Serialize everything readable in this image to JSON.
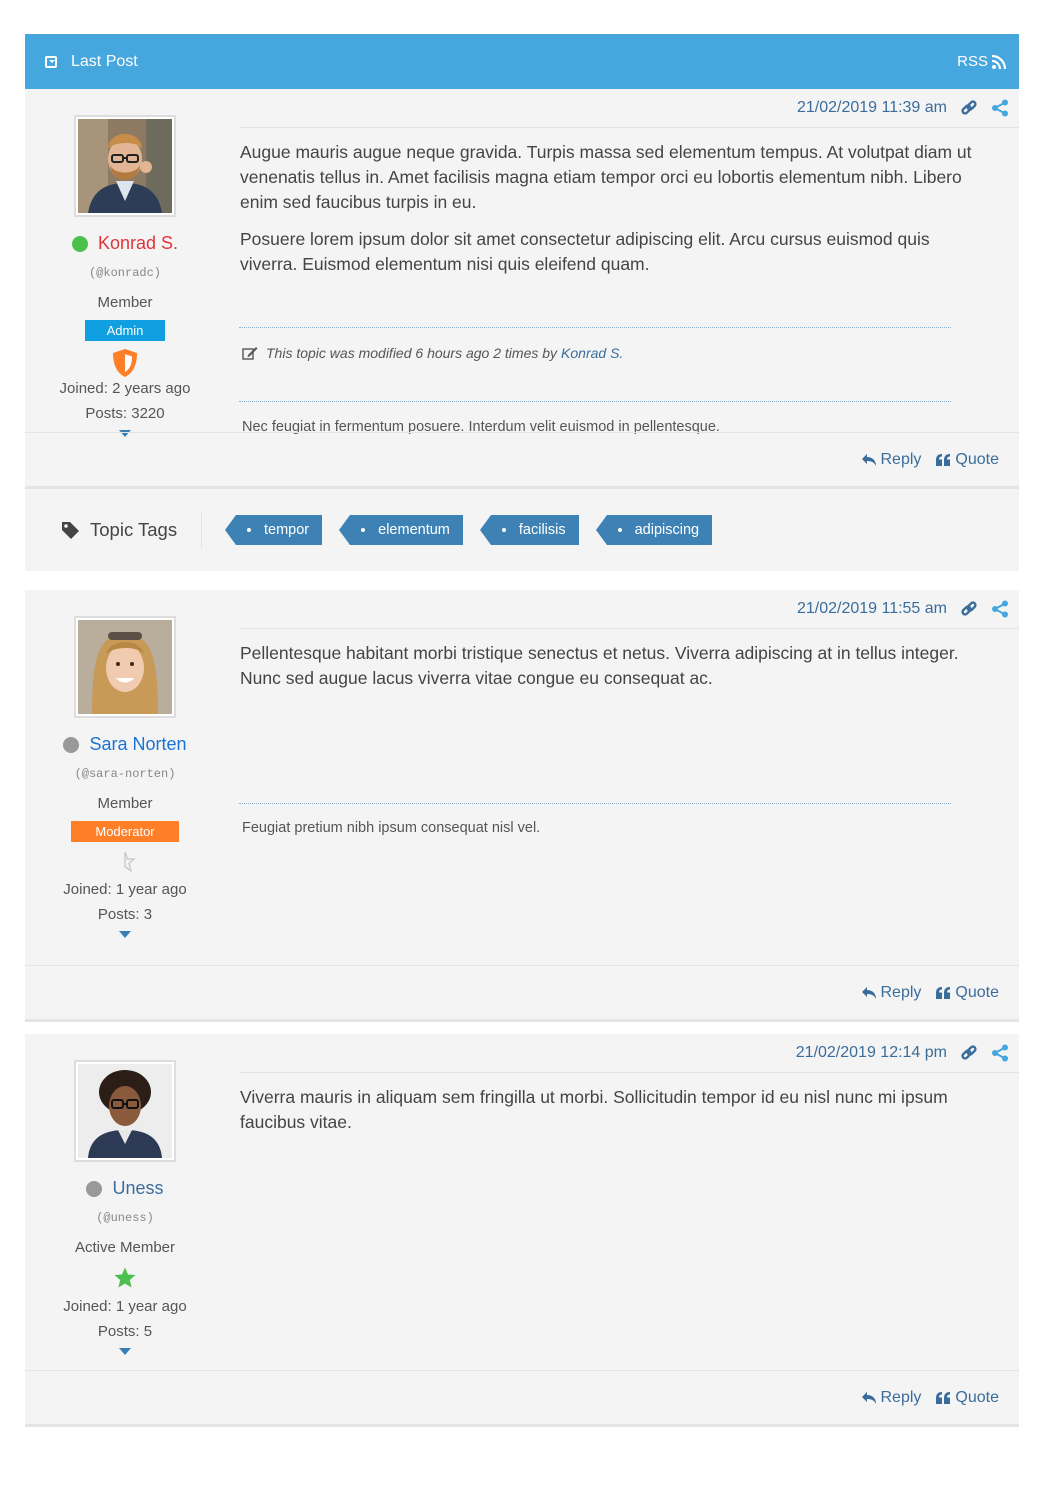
{
  "header": {
    "title": "Last Post",
    "rss_label": "RSS"
  },
  "colors": {
    "header_bg": "#46a6de",
    "link": "#3a6d9c",
    "online": "#4cc04c",
    "offline": "#999999",
    "admin_badge": "#109fe0",
    "moderator_badge": "#ff7f29",
    "tag_bg": "#3e82b5"
  },
  "posts": [
    {
      "date": "21/02/2019 11:39 am",
      "author": {
        "name": "Konrad S.",
        "name_color": "#e0343a",
        "status": "online",
        "handle": "(@konradc)",
        "role": "Member",
        "badge": "Admin",
        "rank_icon": "shield-icon",
        "joined": "Joined: 2 years ago",
        "posts": "Posts: 3220"
      },
      "paragraphs": [
        "Augue mauris augue neque gravida. Turpis massa sed elementum tempus. At volutpat diam ut venenatis tellus in. Amet facilisis magna etiam tempor orci eu lobortis elementum nibh. Libero enim sed faucibus turpis in eu.",
        "Posuere lorem ipsum dolor sit amet consectetur adipiscing elit. Arcu cursus euismod quis viverra. Euismod elementum nisi quis eleifend quam."
      ],
      "modified_text": "This topic was modified 6 hours ago 2 times by",
      "modified_by": "Konrad S.",
      "signature": "Nec feugiat in fermentum posuere. Interdum velit euismod in pellentesque.",
      "reply_label": "Reply",
      "quote_label": "Quote"
    },
    {
      "date": "21/02/2019 11:55 am",
      "author": {
        "name": "Sara Norten",
        "name_color": "#1a73d4",
        "status": "offline",
        "handle": "(@sara-norten)",
        "role": "Member",
        "badge": "Moderator",
        "rank_icon": "half-star-icon",
        "joined": "Joined: 1 year ago",
        "posts": "Posts: 3"
      },
      "paragraphs": [
        "Pellentesque habitant morbi tristique senectus et netus. Viverra adipiscing at in tellus integer. Nunc sed augue lacus viverra vitae congue eu consequat ac."
      ],
      "signature": "Feugiat pretium nibh ipsum consequat nisl vel.",
      "reply_label": "Reply",
      "quote_label": "Quote"
    },
    {
      "date": "21/02/2019 12:14 pm",
      "author": {
        "name": "Uness",
        "name_color": "#3a6d9c",
        "status": "offline",
        "handle": "(@uness)",
        "role": "Active Member",
        "rank_icon": "star-icon",
        "joined": "Joined: 1 year ago",
        "posts": "Posts: 5"
      },
      "paragraphs": [
        "Viverra mauris in aliquam sem fringilla ut morbi. Sollicitudin tempor id eu nisl nunc mi ipsum faucibus vitae."
      ],
      "reply_label": "Reply",
      "quote_label": "Quote"
    }
  ],
  "topic_tags": {
    "label": "Topic Tags",
    "tags": [
      "tempor",
      "elementum",
      "facilisis",
      "adipiscing"
    ]
  }
}
